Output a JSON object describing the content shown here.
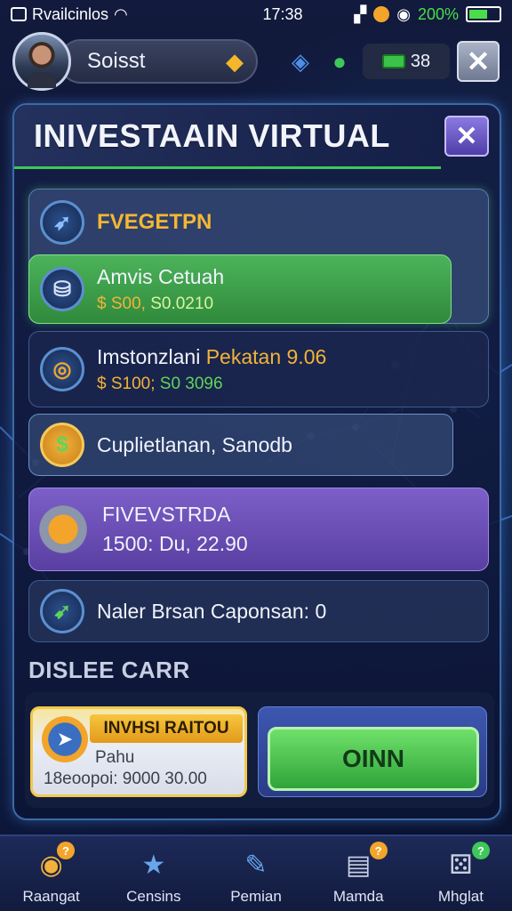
{
  "statusbar": {
    "carrier": "Rvailcinlos",
    "time": "17:38",
    "battery_pct": "200%"
  },
  "header": {
    "username": "Soisst",
    "cash": "38"
  },
  "panel": {
    "title": "INIVESTAAIN VIRTUAL"
  },
  "cards": {
    "category": {
      "label": "FVEGETPN"
    },
    "item1": {
      "title": "Amvis Cetuah",
      "price": "$ S00,",
      "value": "S0.0210"
    },
    "item2": {
      "title": "Imstonzlani",
      "title_accent": "Pekatan 9.06",
      "price": "$ S100;",
      "value": "S0 3096"
    },
    "item3": {
      "title": "Cuplietlanan, Sanodb"
    },
    "item4": {
      "title": "FIVEVSTRDA",
      "value": "1500: Du, 22.90"
    },
    "item5": {
      "title": "Naler Brsan Caponsan: 0"
    }
  },
  "section": {
    "label": "DISLEE CARR"
  },
  "promo": {
    "banner": "INVHSI RAITOU",
    "line1": "Pahu",
    "line2": "18eoopoi: 9000 30.00"
  },
  "action": {
    "label": "OINN"
  },
  "nav": [
    {
      "label": "Raangat",
      "icon": "compass-icon",
      "badge": "?"
    },
    {
      "label": "Censins",
      "icon": "star-icon"
    },
    {
      "label": "Pemian",
      "icon": "pencil-icon"
    },
    {
      "label": "Mamda",
      "icon": "document-icon",
      "badge": "?"
    },
    {
      "label": "Mhglat",
      "icon": "dice-icon",
      "badge": "?"
    }
  ],
  "colors": {
    "accent_green": "#3fc75a",
    "gold": "#f2b23a",
    "purple": "#7c5fc8",
    "navy": "#0c1330"
  }
}
